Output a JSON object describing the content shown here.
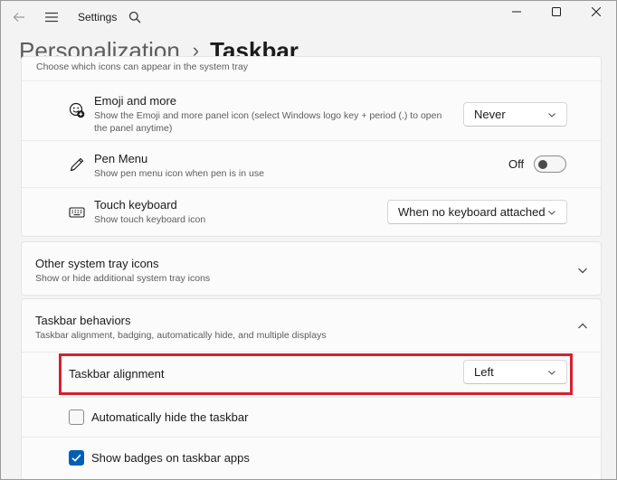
{
  "window": {
    "app_title": "Settings"
  },
  "header": {
    "breadcrumb_parent": "Personalization",
    "breadcrumb_separator": "›",
    "breadcrumb_current": "Taskbar"
  },
  "system_tray": {
    "partial_desc": "Choose which icons can appear in the system tray",
    "items": [
      {
        "title": "Emoji and more",
        "desc": "Show the Emoji and more panel icon (select Windows logo key + period (.) to open the panel anytime)",
        "control": "dropdown",
        "value": "Never"
      },
      {
        "title": "Pen Menu",
        "desc": "Show pen menu icon when pen is in use",
        "control": "toggle",
        "value": "Off"
      },
      {
        "title": "Touch keyboard",
        "desc": "Show touch keyboard icon",
        "control": "dropdown",
        "value": "When no keyboard attached"
      }
    ]
  },
  "other_tray": {
    "title": "Other system tray icons",
    "desc": "Show or hide additional system tray icons"
  },
  "behaviors": {
    "title": "Taskbar behaviors",
    "desc": "Taskbar alignment, badging, automatically hide, and multiple displays",
    "alignment_label": "Taskbar alignment",
    "alignment_value": "Left",
    "autohide_label": "Automatically hide the taskbar",
    "autohide_checked": false,
    "badges_label": "Show badges on taskbar apps",
    "badges_checked": true
  },
  "colors": {
    "accent": "#005fb8",
    "highlight": "#d6202f"
  }
}
